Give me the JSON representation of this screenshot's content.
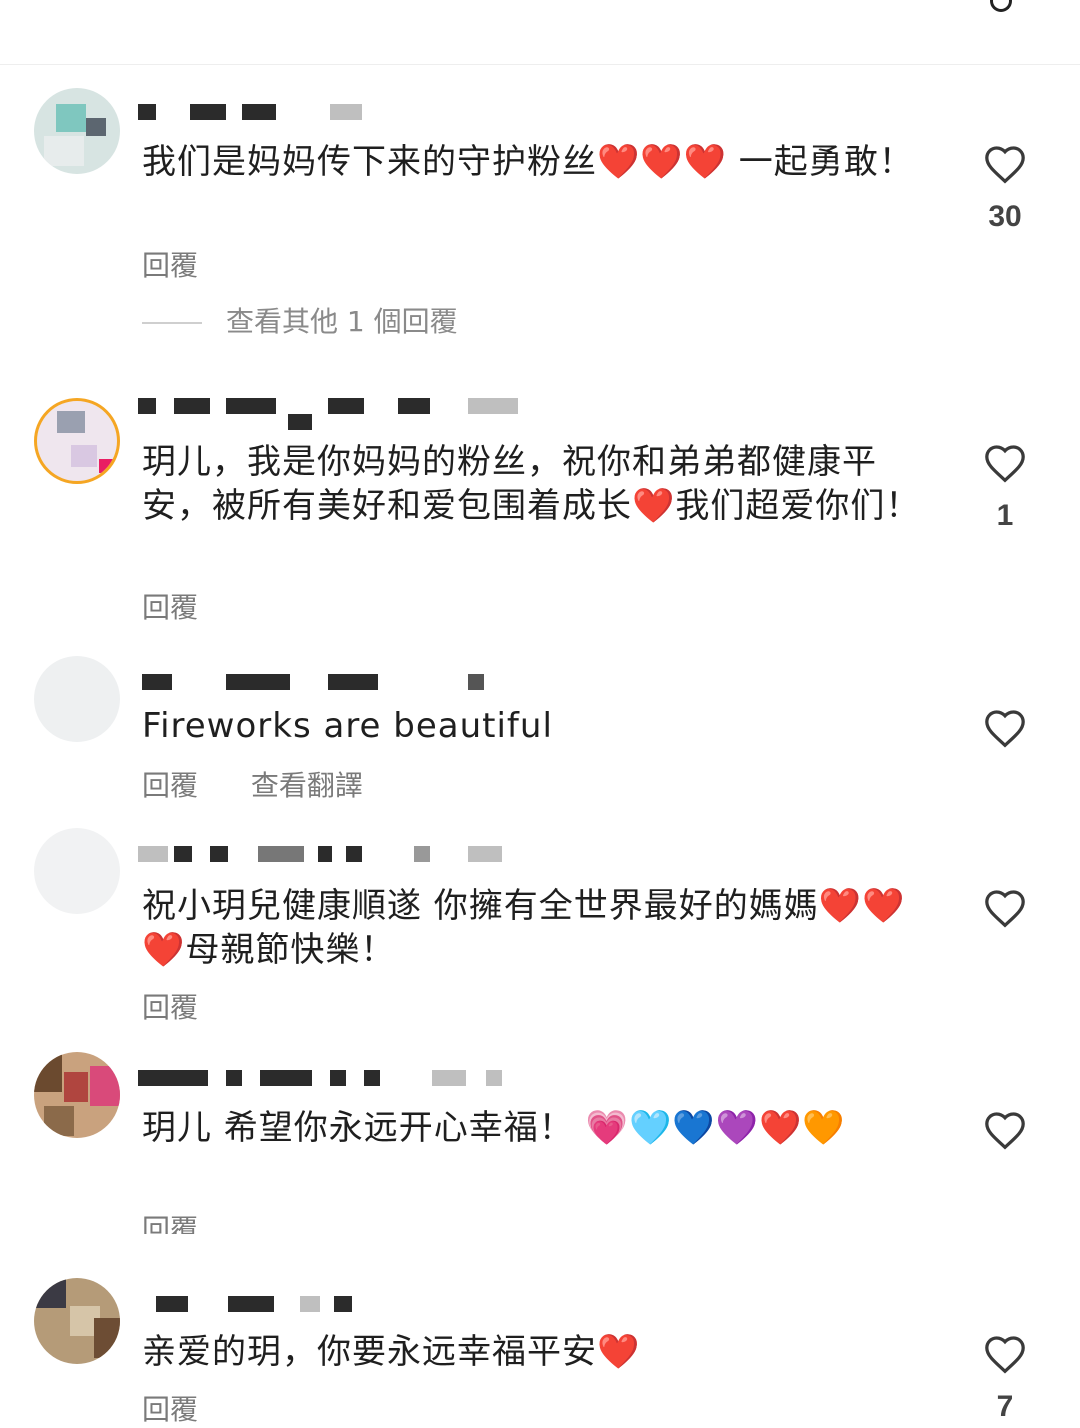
{
  "comments": [
    {
      "text": "我们是妈妈传下来的守护粉丝❤️❤️❤️ 一起勇敢！",
      "reply_label": "回覆",
      "likes": "30",
      "view_more": "查看其他 1 個回覆"
    },
    {
      "text": "玥儿，我是你妈妈的粉丝，祝你和弟弟都健康平安，被所有美好和爱包围着成长❤️我们超爱你们！",
      "reply_label": "回覆",
      "likes": "1"
    },
    {
      "text": "Fireworks are beautiful",
      "reply_label": "回覆",
      "translate_label": "查看翻譯",
      "likes": ""
    },
    {
      "text": "祝小玥兒健康順遂 你擁有全世界最好的媽媽❤️❤️❤️母親節快樂！",
      "reply_label": "回覆",
      "likes": ""
    },
    {
      "text": "玥儿 希望你永远开心幸福！ 💗🩵💙💜❤️🧡",
      "reply_label": "回覆",
      "likes": ""
    },
    {
      "text": "亲爱的玥，你要永远幸福平安❤️",
      "reply_label": "回覆",
      "likes": "7"
    }
  ],
  "colors": {
    "heart_outline": "#3a3a3a",
    "action_text": "#7a7a7a"
  },
  "icons": {
    "like": "heart-outline-icon"
  }
}
